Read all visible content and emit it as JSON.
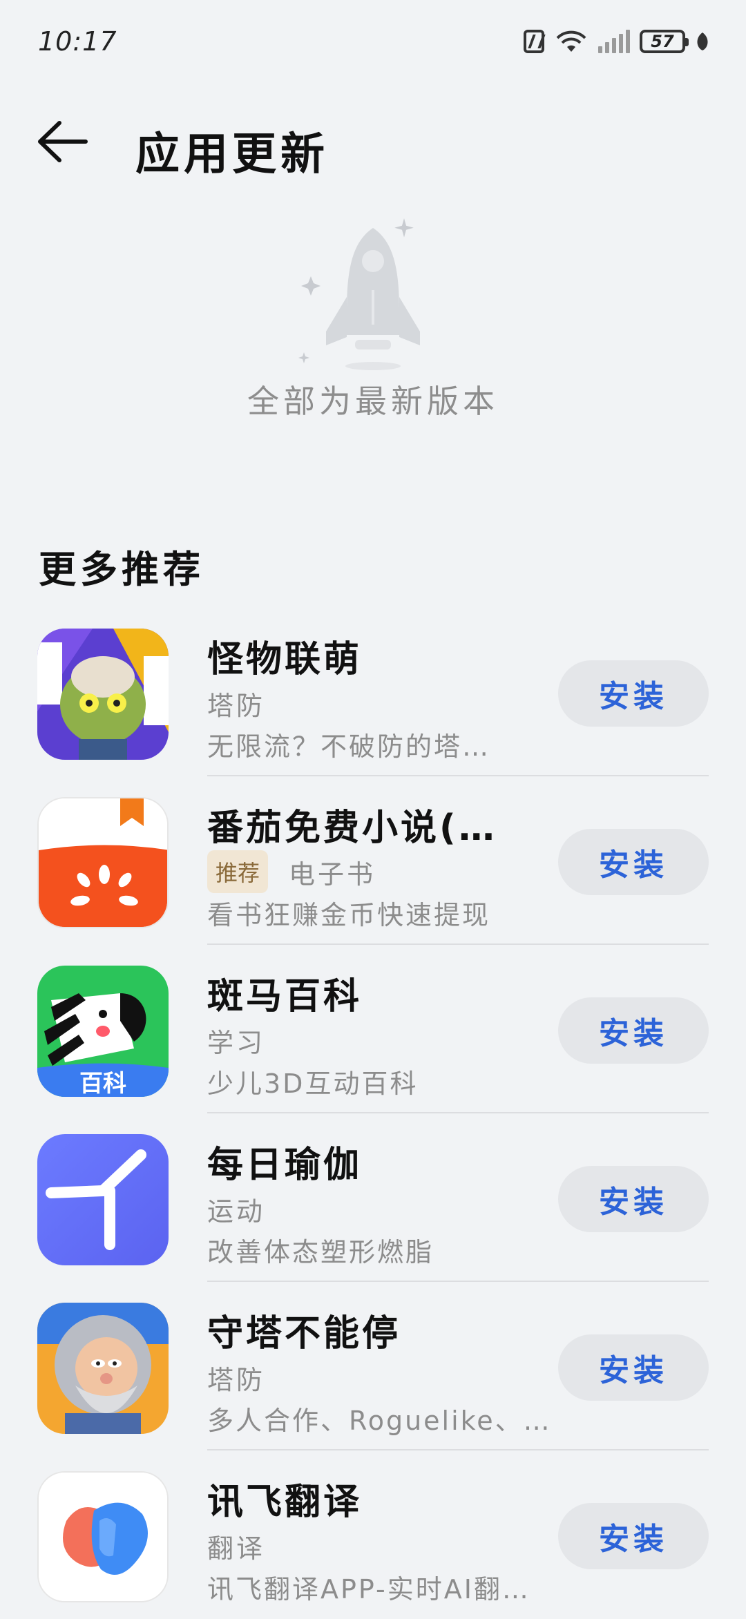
{
  "status_bar": {
    "time": "10:17",
    "battery": "57"
  },
  "header": {
    "title": "应用更新"
  },
  "empty_state": {
    "text": "全部为最新版本"
  },
  "section": {
    "title": "更多推荐"
  },
  "apps": [
    {
      "name": "怪物联萌",
      "category": "塔防",
      "badge": "",
      "desc": "无限流？不破防的塔…",
      "action": "安装"
    },
    {
      "name": "番茄免费小说(…",
      "category": "电子书",
      "badge": "推荐",
      "desc": "看书狂赚金币快速提现",
      "action": "安装"
    },
    {
      "name": "斑马百科",
      "category": "学习",
      "badge": "",
      "desc": "少儿3D互动百科",
      "action": "安装",
      "icon_text": "百科"
    },
    {
      "name": "每日瑜伽",
      "category": "运动",
      "badge": "",
      "desc": "改善体态塑形燃脂",
      "action": "安装"
    },
    {
      "name": "守塔不能停",
      "category": "塔防",
      "badge": "",
      "desc": "多人合作、Roguelike、…",
      "action": "安装"
    },
    {
      "name": "讯飞翻译",
      "category": "翻译",
      "badge": "",
      "desc": "讯飞翻译APP-实时AI翻…",
      "action": "安装"
    }
  ],
  "colors": {
    "accent": "#2c63d8",
    "background": "#f1f3f5"
  }
}
